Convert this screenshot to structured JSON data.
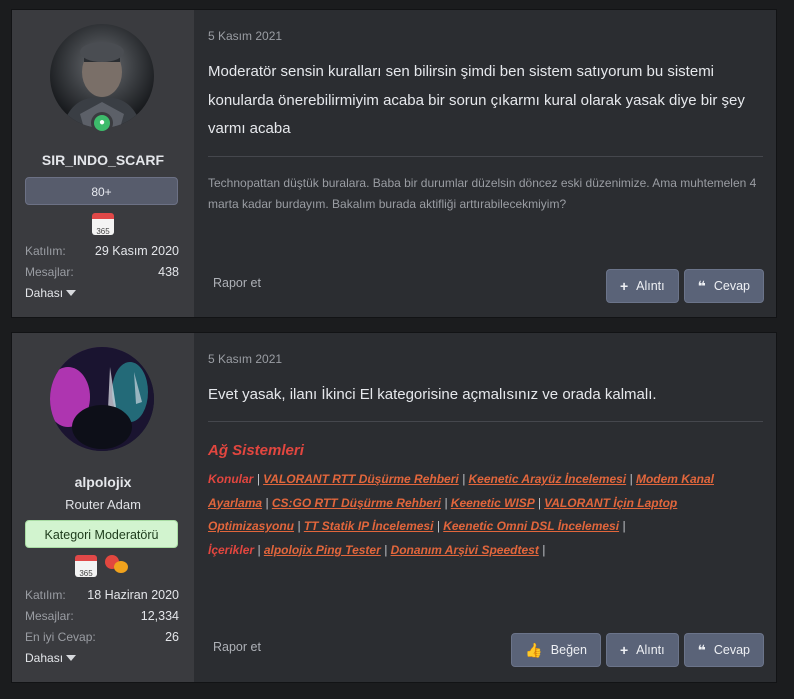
{
  "posts": [
    {
      "user": {
        "name": "SIR_INDO_SCARF",
        "rank_banner": "80+",
        "stats": [
          {
            "label": "Katılım:",
            "value": "29 Kasım 2020"
          },
          {
            "label": "Mesajlar:",
            "value": "438"
          }
        ],
        "more_label": "Dahası"
      },
      "date": "5 Kasım 2021",
      "message": "Moderatör sensin kuralları sen bilirsin şimdi ben sistem satıyorum bu sistemi konularda önerebilirmiyim acaba bir sorun çıkarmı kural olarak yasak diye bir şey varmı acaba",
      "signature": "Technopattan düştük buralara. Baba bir durumlar düzelsin döncez eski düzenimize. Ama muhtemelen 4 marta kadar burdayım. Bakalım burada aktifliği arttırabilecekmiyim?",
      "report_label": "Rapor et",
      "buttons": {
        "quote": "Alıntı",
        "reply": "Cevap"
      }
    },
    {
      "user": {
        "name": "alpolojix",
        "title": "Router Adam",
        "moderator_banner": "Kategori Moderatörü",
        "stats": [
          {
            "label": "Katılım:",
            "value": "18 Haziran 2020"
          },
          {
            "label": "Mesajlar:",
            "value": "12,334"
          },
          {
            "label": "En iyi Cevap:",
            "value": "26"
          }
        ],
        "more_label": "Dahası"
      },
      "date": "5 Kasım 2021",
      "message": "Evet yasak, ilanı İkinci El kategorisine açmalısınız ve orada kalmalı.",
      "signature_heading": "Ağ Sistemleri",
      "signature_lines": {
        "konular_label": "Konular",
        "konular": [
          "VALORANT RTT Düşürme Rehberi",
          "Keenetic Arayüz İncelemesi",
          "Modem Kanal Ayarlama",
          "CS:GO RTT Düşürme Rehberi",
          "Keenetic WISP",
          "VALORANT İçin Laptop Optimizasyonu",
          "TT Statik IP İncelemesi",
          "Keenetic Omni DSL İncelemesi"
        ],
        "icerikler_label": "İçerikler",
        "icerikler": [
          "alpolojix Ping Tester",
          "Donanım Arşivi Speedtest"
        ]
      },
      "report_label": "Rapor et",
      "buttons": {
        "like": "Beğen",
        "quote": "Alıntı",
        "reply": "Cevap"
      }
    }
  ],
  "icons": [
    "online-status-icon",
    "calendar-365-icon",
    "chat-bubbles-icon",
    "caret-down-icon",
    "plus-icon",
    "quote-icon",
    "thumbs-up-icon"
  ],
  "colors": {
    "signature_heading": "#e2463f",
    "signature_link": "#e2663c",
    "moderator_banner": "#d2f4cf",
    "online": "#3dbb6b"
  }
}
